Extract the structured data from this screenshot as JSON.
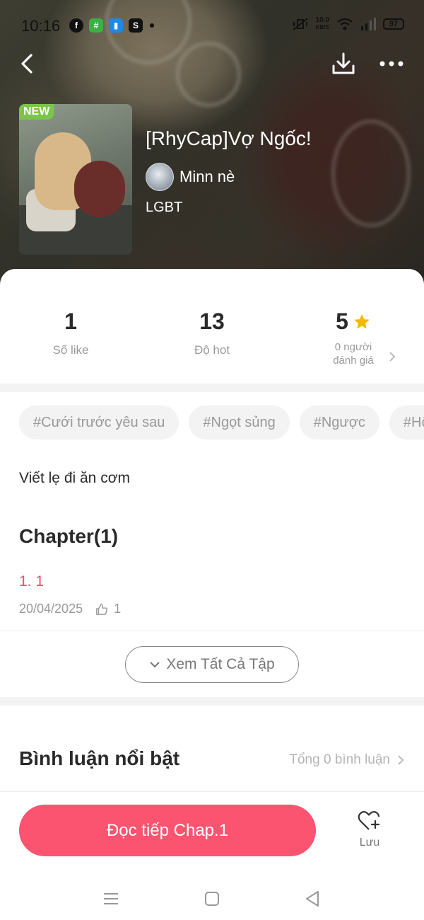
{
  "status_bar": {
    "time": "10:16",
    "net_speed_value": "10.0",
    "net_speed_unit": "KB/S",
    "battery": "97",
    "app_icons": [
      "facebook-icon",
      "messenger-green-icon",
      "blue-app-icon",
      "shopee-icon"
    ]
  },
  "story": {
    "badge": "NEW",
    "title": "[RhyCap]Vợ Ngốc!",
    "author": "Minn nè",
    "genre": "LGBT"
  },
  "stats": {
    "likes": {
      "value": "1",
      "label": "Số like"
    },
    "hot": {
      "value": "13",
      "label": "Độ hot"
    },
    "rating": {
      "value": "5",
      "label_line1": "0 người",
      "label_line2": "đánh giá"
    }
  },
  "tags": [
    "#Cưới trước yêu sau",
    "#Ngọt sủng",
    "#Ngược",
    "#Hô"
  ],
  "summary": "Viết lẹ đi ăn cơm",
  "chapters": {
    "heading": "Chapter(1)",
    "items": [
      {
        "title": "1. 1",
        "date": "20/04/2025",
        "likes": "1"
      }
    ],
    "view_all_label": "Xem Tất Cả Tập"
  },
  "comments": {
    "heading": "Bình luận nổi bật",
    "total_label": "Tổng 0 bình luận"
  },
  "actions": {
    "read_label": "Đọc tiếp Chap.1",
    "save_label": "Lưu"
  },
  "colors": {
    "accent": "#fb5471",
    "chapter_title": "#e8506a",
    "new_badge": "#7ac64a",
    "star": "#f5b800"
  }
}
